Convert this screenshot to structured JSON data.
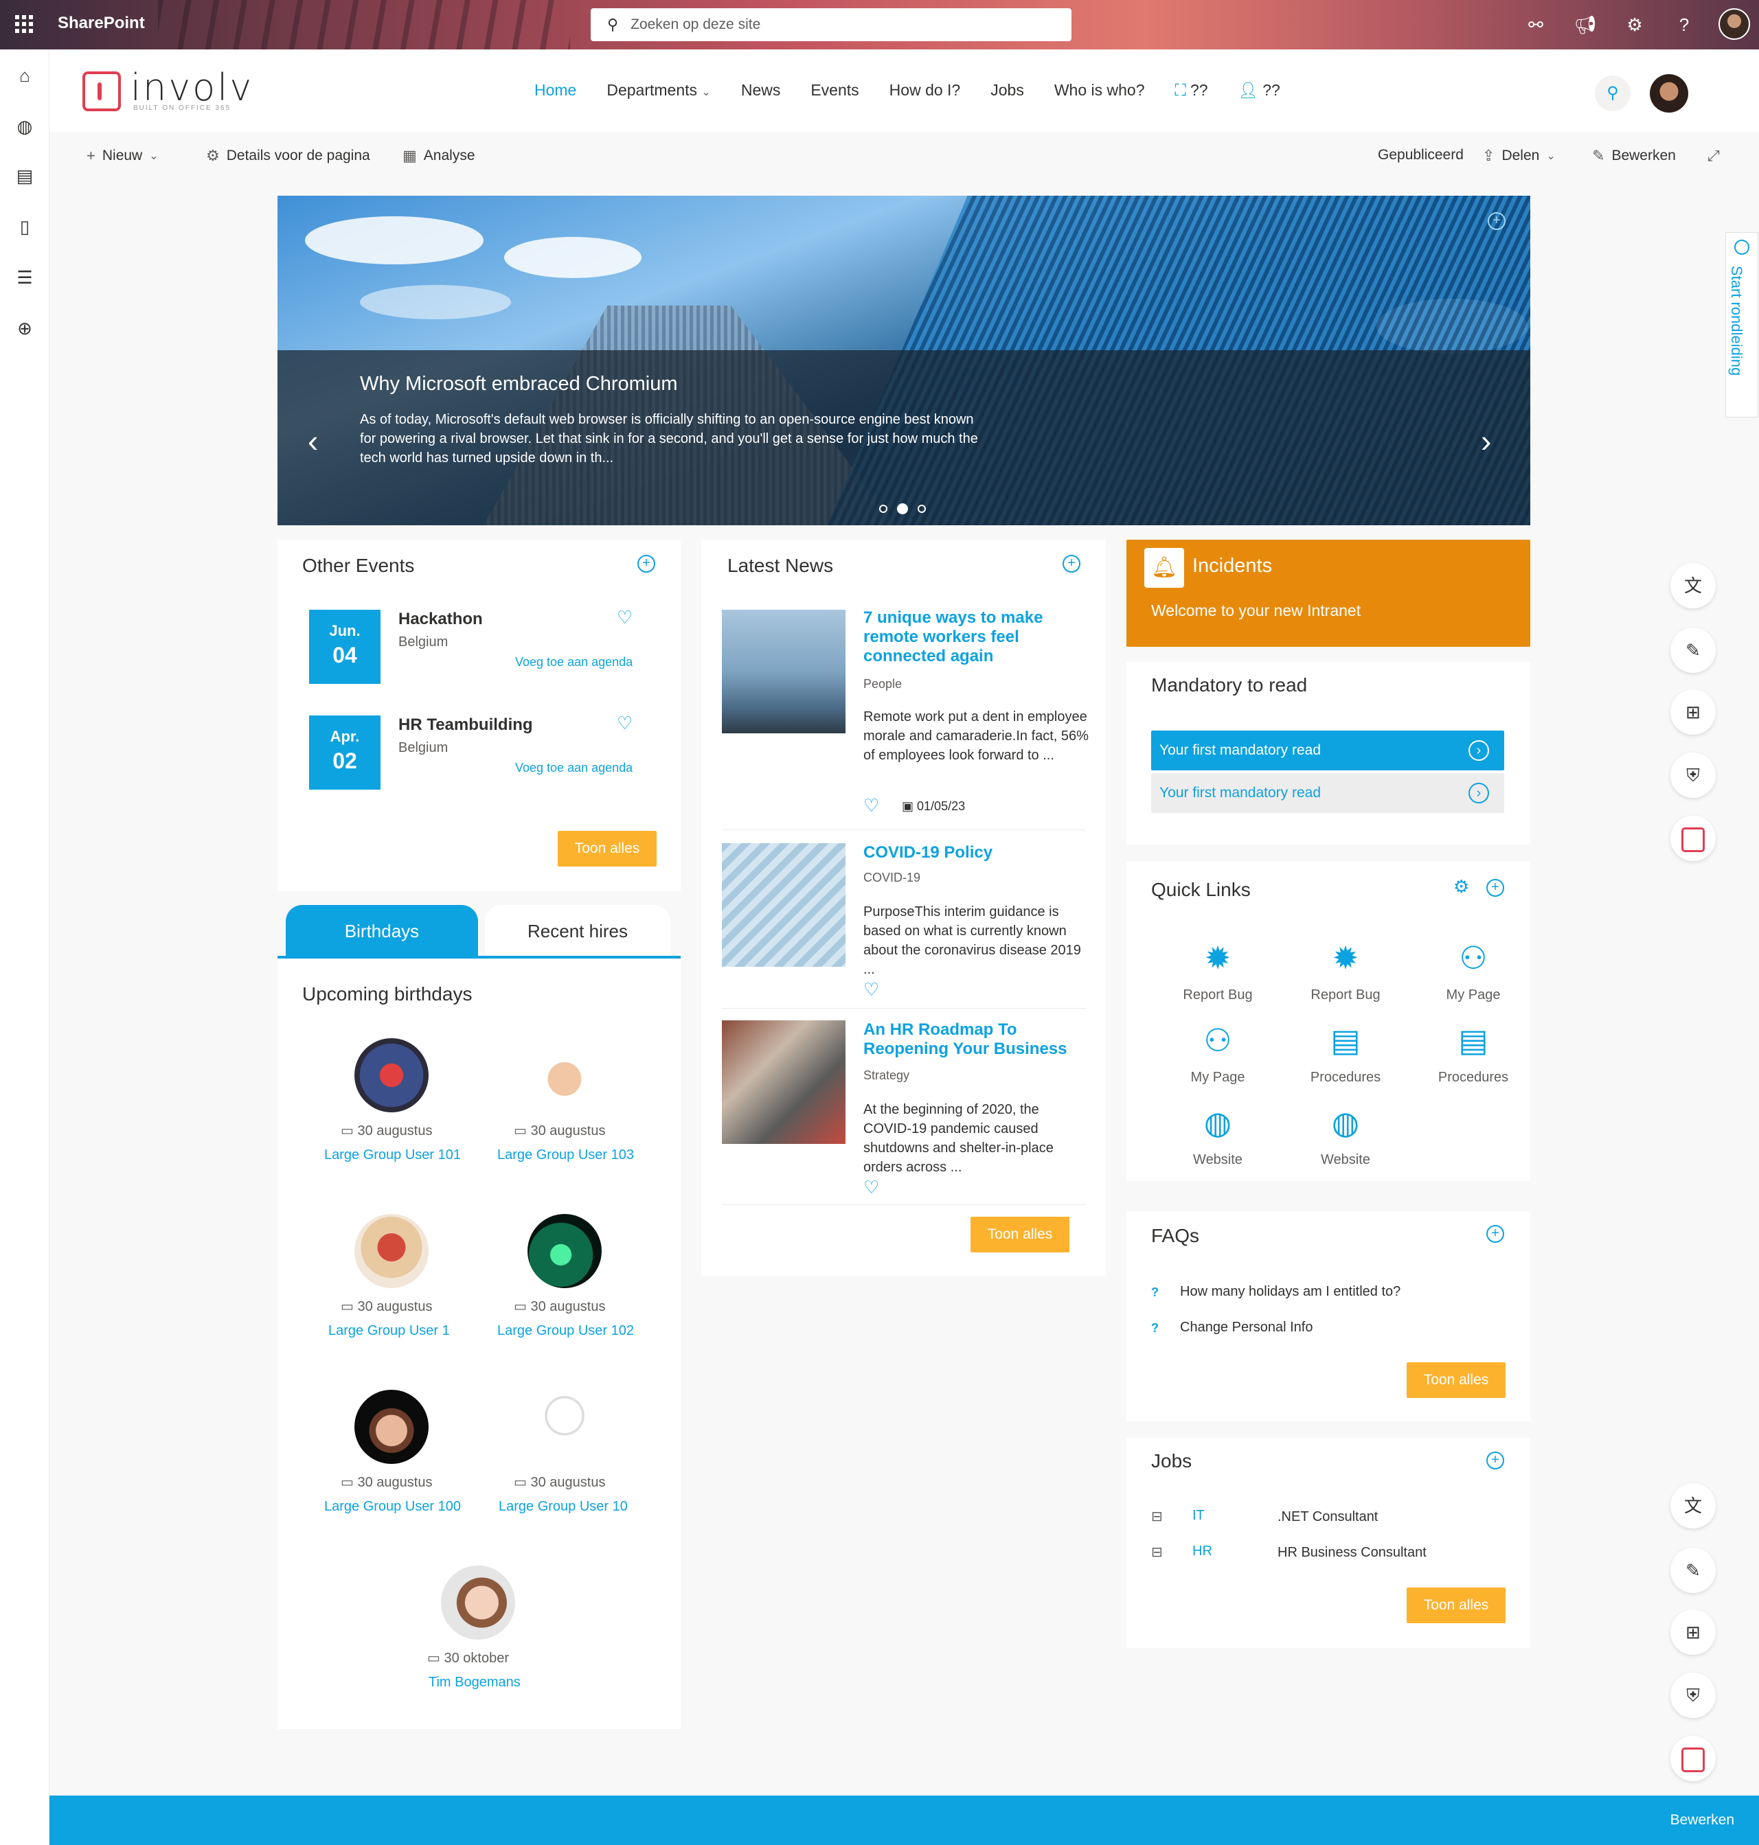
{
  "suite": {
    "app_name": "SharePoint",
    "search_placeholder": "Zoeken op deze site"
  },
  "header": {
    "logo_text": "involv",
    "logo_sub": "BUILT ON OFFICE 365",
    "nav": [
      "Home",
      "Departments",
      "News",
      "Events",
      "How do I?",
      "Jobs",
      "Who is who?",
      "??",
      "??"
    ]
  },
  "command_bar": {
    "new": "Nieuw",
    "details": "Details voor de pagina",
    "analytics": "Analyse",
    "published": "Gepubliceerd",
    "share": "Delen",
    "edit": "Bewerken"
  },
  "hero": {
    "title": "Why Microsoft embraced Chromium",
    "description": "As of today, Microsoft's default web browser is officially shifting to an open-source engine best known for powering a rival browser. Let that sink in for a second, and you'll get a sense for just how much the tech world has turned upside down in th...",
    "slide_count": 3,
    "active_slide": 2
  },
  "events": {
    "title": "Other Events",
    "items": [
      {
        "month": "Jun.",
        "day": "04",
        "title": "Hackathon",
        "location": "Belgium",
        "link": "Voeg toe aan agenda"
      },
      {
        "month": "Apr.",
        "day": "02",
        "title": "HR Teambuilding",
        "location": "Belgium",
        "link": "Voeg toe aan agenda"
      }
    ],
    "button": "Toon alles"
  },
  "people_tabs": {
    "active": "Birthdays",
    "other": "Recent hires"
  },
  "birthdays": {
    "title": "Upcoming birthdays",
    "items": [
      {
        "date": "30 augustus",
        "name": "Large Group User 101"
      },
      {
        "date": "30 augustus",
        "name": "Large Group User 103"
      },
      {
        "date": "30 augustus",
        "name": "Large Group User 1"
      },
      {
        "date": "30 augustus",
        "name": "Large Group User 102"
      },
      {
        "date": "30 augustus",
        "name": "Large Group User 100"
      },
      {
        "date": "30 augustus",
        "name": "Large Group User 10"
      },
      {
        "date": "30 oktober",
        "name": "Tim Bogemans"
      }
    ]
  },
  "news": {
    "title": "Latest News",
    "items": [
      {
        "title": "7 unique ways to make remote workers feel connected again",
        "category": "People",
        "description": "Remote work put a dent in employee morale and camaraderie.In fact, 56% of employees look forward to ...",
        "date": "01/05/23"
      },
      {
        "title": "COVID-19 Policy",
        "category": "COVID-19",
        "description": "PurposeThis interim guidance is based on what is currently known about the coronavirus disease 2019 ..."
      },
      {
        "title": "An HR Roadmap To Reopening Your Business",
        "category": "Strategy",
        "description": "At the beginning of 2020, the COVID-19 pandemic caused shutdowns and shelter-in-place orders across ..."
      }
    ],
    "button": "Toon alles"
  },
  "incidents": {
    "title": "Incidents",
    "message": "Welcome to your new Intranet",
    "color": "#e78a0b"
  },
  "mandatory": {
    "title": "Mandatory to read",
    "items": [
      "Your first mandatory read",
      "Your first mandatory read"
    ]
  },
  "quick_links": {
    "title": "Quick Links",
    "items": [
      {
        "label": "Report Bug",
        "icon": "bug-icon"
      },
      {
        "label": "Report Bug",
        "icon": "bug-icon"
      },
      {
        "label": "My Page",
        "icon": "people-star-icon"
      },
      {
        "label": "My Page",
        "icon": "people-star-icon"
      },
      {
        "label": "Procedures",
        "icon": "document-icon"
      },
      {
        "label": "Procedures",
        "icon": "document-icon"
      },
      {
        "label": "Website",
        "icon": "globe-icon"
      },
      {
        "label": "Website",
        "icon": "globe-icon"
      }
    ]
  },
  "faqs": {
    "title": "FAQs",
    "items": [
      "How many holidays am I entitled to?",
      "Change Personal Info"
    ],
    "button": "Toon alles"
  },
  "jobs": {
    "title": "Jobs",
    "items": [
      {
        "department": "IT",
        "role": ".NET Consultant"
      },
      {
        "department": "HR",
        "role": "HR Business Consultant"
      }
    ],
    "button": "Toon alles"
  },
  "tour": {
    "label": "Start rondleiding"
  },
  "footer": {
    "edit": "Bewerken"
  },
  "colors": {
    "accent": "#0da2e0",
    "button": "#fdb22e",
    "brand": "#e03e52"
  }
}
